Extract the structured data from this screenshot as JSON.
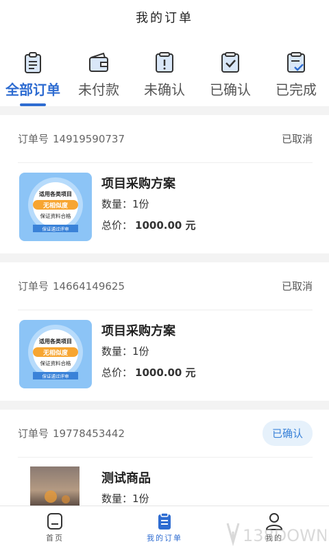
{
  "header": {
    "title": "我的订单"
  },
  "tabs": [
    {
      "label": "全部订单",
      "icon": "clipboard-list-icon",
      "active": true
    },
    {
      "label": "未付款",
      "icon": "wallet-icon",
      "active": false
    },
    {
      "label": "未确认",
      "icon": "alert-box-icon",
      "active": false
    },
    {
      "label": "已确认",
      "icon": "check-box-icon",
      "active": false
    },
    {
      "label": "已完成",
      "icon": "clipboard-check-icon",
      "active": false
    }
  ],
  "orders": [
    {
      "order_label": "订单号",
      "order_no": "14919590737",
      "status": "已取消",
      "product": {
        "name": "项目采购方案",
        "qty_label": "数量：",
        "qty": "1份",
        "total_label": "总价：",
        "total": "1000.00 元",
        "thumb_lines": [
          "适用各类项目",
          "无相似度",
          "保证资料合格",
          "保证通过评审"
        ]
      }
    },
    {
      "order_label": "订单号",
      "order_no": "14664149625",
      "status": "已取消",
      "product": {
        "name": "项目采购方案",
        "qty_label": "数量：",
        "qty": "1份",
        "total_label": "总价：",
        "total": "1000.00 元",
        "thumb_lines": [
          "适用各类项目",
          "无相似度",
          "保证资料合格",
          "保证通过评审"
        ]
      }
    },
    {
      "order_label": "订单号",
      "order_no": "19778453442",
      "status": "已确认",
      "product": {
        "name": "测试商品",
        "qty_label": "数量：",
        "qty": "1份"
      }
    }
  ],
  "bottom_nav": [
    {
      "label": "首页",
      "icon": "home-icon",
      "active": false
    },
    {
      "label": "我的订单",
      "icon": "order-clipboard-icon",
      "active": true
    },
    {
      "label": "我的",
      "icon": "user-icon",
      "active": false
    }
  ],
  "watermark": {
    "text": "138DOWN"
  },
  "colors": {
    "accent": "#2e6cd1",
    "status_pill_bg": "#e6f1fb",
    "status_pill_text": "#3a82d8"
  }
}
